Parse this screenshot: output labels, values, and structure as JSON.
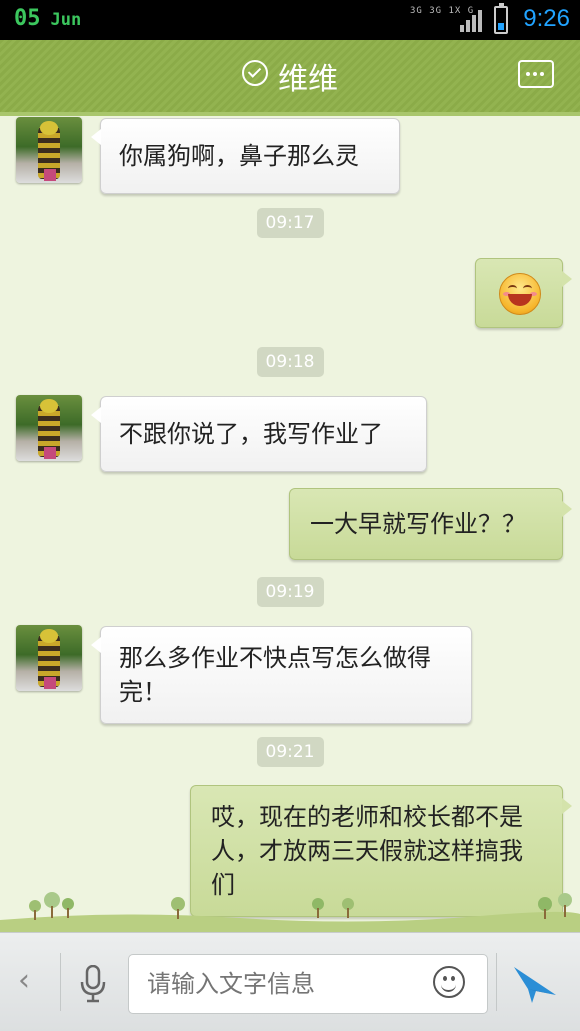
{
  "status_bar": {
    "day": "05",
    "month": "Jun",
    "network": "3G 3G 1X G",
    "time": "9:26"
  },
  "header": {
    "contact_name": "维维"
  },
  "messages": [
    {
      "type": "incoming",
      "text": "你属狗啊，鼻子那么灵"
    },
    {
      "type": "time",
      "text": "09:17"
    },
    {
      "type": "outgoing_emoji",
      "emoji": "grin-emoji"
    },
    {
      "type": "time",
      "text": "09:18"
    },
    {
      "type": "incoming",
      "text": "不跟你说了，我写作业了"
    },
    {
      "type": "outgoing",
      "text": "一大早就写作业？？"
    },
    {
      "type": "time",
      "text": "09:19"
    },
    {
      "type": "incoming",
      "text": "那么多作业不快点写怎么做得完！"
    },
    {
      "type": "time",
      "text": "09:21"
    },
    {
      "type": "outgoing",
      "text": "哎，现在的老师和校长都不是人，才放两三天假就这样搞我们"
    }
  ],
  "input_bar": {
    "placeholder": "请输入文字信息",
    "back_label": "‹"
  },
  "colors": {
    "header_green": "#8bab48",
    "chat_bg": "#eef4df",
    "out_bubble": "#cfe0a6",
    "send_blue": "#2b8ed6"
  }
}
